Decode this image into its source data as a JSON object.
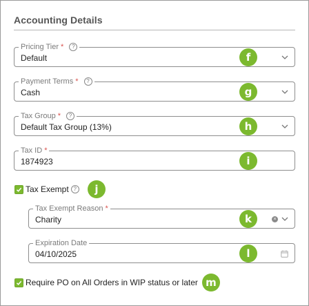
{
  "section": {
    "title": "Accounting Details"
  },
  "fields": {
    "pricing_tier": {
      "label": "Pricing Tier",
      "required": "*",
      "value": "Default",
      "badge": "f"
    },
    "payment_terms": {
      "label": "Payment Terms",
      "required": "*",
      "value": "Cash",
      "badge": "g"
    },
    "tax_group": {
      "label": "Tax Group",
      "required": "*",
      "value": "Default Tax Group (13%)",
      "badge": "h"
    },
    "tax_id": {
      "label": "Tax ID",
      "required": "*",
      "value": "1874923",
      "badge": "i"
    },
    "tax_exempt": {
      "label": "Tax Exempt",
      "checked": true,
      "badge": "j"
    },
    "tax_exempt_reason": {
      "label": "Tax Exempt Reason",
      "required": "*",
      "value": "Charity",
      "badge": "k"
    },
    "expiration_date": {
      "label": "Expiration Date",
      "value": "04/10/2025",
      "badge": "l"
    },
    "require_po": {
      "label": "Require PO on All Orders in WIP status or later",
      "checked": true,
      "badge": "m"
    }
  },
  "icons": {
    "help": "?",
    "clear": "×"
  },
  "colors": {
    "accent_green": "#7cb92f",
    "border": "#8d8d8d",
    "required": "#d9534f"
  }
}
